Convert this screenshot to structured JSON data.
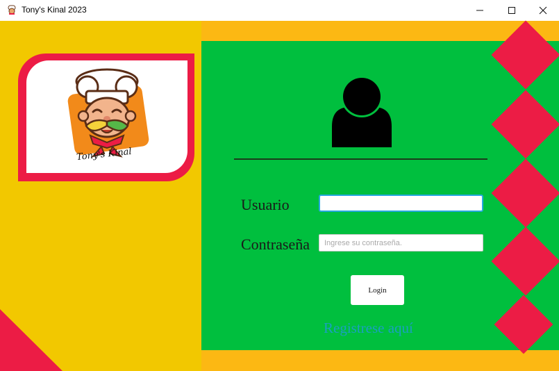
{
  "window": {
    "title": "Tony's Kinal 2023",
    "controls": {
      "minimize": "minimize-icon",
      "maximize": "maximize-icon",
      "close": "close-icon"
    }
  },
  "logo": {
    "caption": "Tony's Kinal",
    "image": "chef-mascot"
  },
  "form": {
    "icon": "user-icon",
    "username_label": "Usuario",
    "username_value": "",
    "password_label": "Contraseña",
    "password_placeholder": "Ingrese su contraseña.",
    "login_button": "Login",
    "register_link": "Registrese aquí"
  },
  "colors": {
    "left_panel": "#f2c800",
    "frame": "#fcb813",
    "green_panel": "#00bf3e",
    "accent_red": "#ec1c45",
    "link": "#1aa0c0"
  }
}
